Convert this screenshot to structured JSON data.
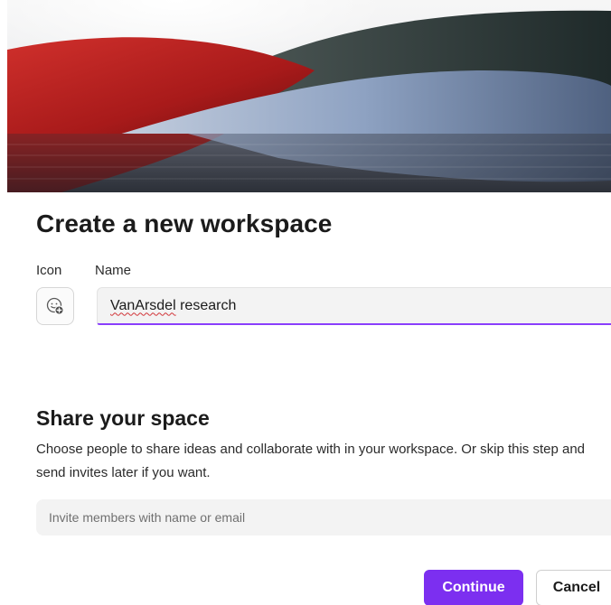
{
  "dialog": {
    "title": "Create a new workspace",
    "icon_label": "Icon",
    "name_label": "Name",
    "icon_button": "add-emoji-icon",
    "name_value_misspelled": "VanArsdel",
    "name_value_rest": " research",
    "share_title": "Share your space",
    "share_description": "Choose people to share ideas and collaborate with in your workspace. Or skip this step and send invites later if you want.",
    "invite_placeholder": "Invite members with name or email",
    "continue_label": "Continue",
    "cancel_label": "Cancel"
  },
  "colors": {
    "accent": "#7c2ff0",
    "focus_underline": "#8a3ffc",
    "hero_red": "#b51f1f",
    "hero_dark_teal": "#2e3b3a",
    "hero_blue": "#8fa3c2"
  }
}
